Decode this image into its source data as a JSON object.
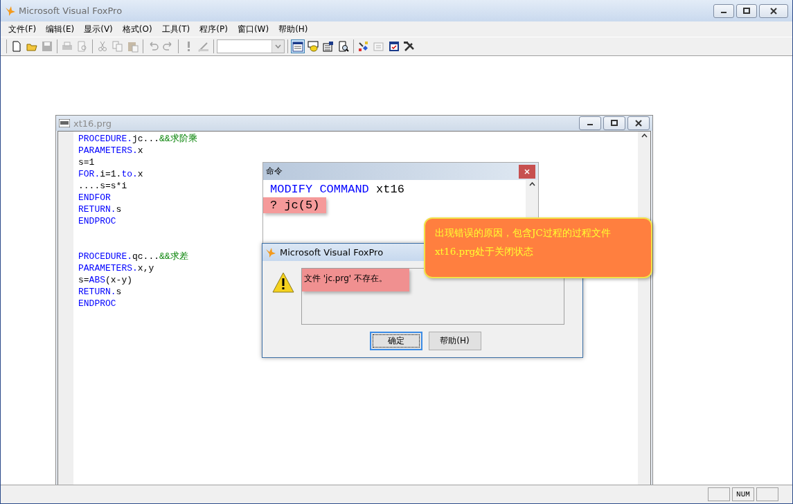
{
  "window": {
    "title": "Microsoft Visual FoxPro"
  },
  "menu": [
    "文件(F)",
    "编辑(E)",
    "显示(V)",
    "格式(O)",
    "工具(T)",
    "程序(P)",
    "窗口(W)",
    "帮助(H)"
  ],
  "toolbar": [
    [
      {
        "kind": "new",
        "disabled": false
      },
      {
        "kind": "open",
        "disabled": false
      },
      {
        "kind": "save",
        "disabled": true
      }
    ],
    [
      {
        "kind": "print",
        "disabled": true
      },
      {
        "kind": "preview",
        "disabled": true
      }
    ],
    [
      {
        "kind": "cut",
        "disabled": true
      },
      {
        "kind": "copy",
        "disabled": true
      },
      {
        "kind": "paste",
        "disabled": true
      }
    ],
    [
      {
        "kind": "undo",
        "disabled": true
      },
      {
        "kind": "redo",
        "disabled": true
      }
    ],
    [
      {
        "kind": "run",
        "disabled": true
      },
      {
        "kind": "wizard",
        "disabled": true
      }
    ],
    [
      {
        "kind": "combo",
        "disabled": true
      }
    ],
    [
      {
        "kind": "command",
        "disabled": false,
        "selected": true
      },
      {
        "kind": "data",
        "disabled": false,
        "selected": false
      },
      {
        "kind": "properties",
        "disabled": false,
        "selected": false
      },
      {
        "kind": "find",
        "disabled": false,
        "selected": false
      }
    ],
    [
      {
        "kind": "builder",
        "disabled": false
      },
      {
        "kind": "autoformat",
        "disabled": true
      },
      {
        "kind": "form",
        "disabled": false
      },
      {
        "kind": "tools",
        "disabled": false
      }
    ]
  ],
  "editor": {
    "title": "xt16.prg",
    "blocks": [
      [
        [
          {
            "text": "PROCEDURE.",
            "kind": "keyword"
          },
          {
            "text": "jc...",
            "kind": "plain"
          },
          {
            "text": "&&求阶乘",
            "kind": "comment"
          }
        ],
        [
          {
            "text": "PARAMETERS.",
            "kind": "keyword"
          },
          {
            "text": "x",
            "kind": "plain"
          }
        ],
        [
          {
            "text": "s=1",
            "kind": "plain"
          }
        ],
        [
          {
            "text": "FOR.",
            "kind": "keyword"
          },
          {
            "text": "i=1.",
            "kind": "plain"
          },
          {
            "text": "to.",
            "kind": "keyword"
          },
          {
            "text": "x",
            "kind": "plain"
          }
        ],
        [
          {
            "text": "....s=s*i",
            "kind": "plain"
          }
        ],
        [
          {
            "text": "ENDFOR",
            "kind": "keyword"
          }
        ],
        [
          {
            "text": "RETURN.",
            "kind": "keyword"
          },
          {
            "text": "s",
            "kind": "plain"
          }
        ],
        [
          {
            "text": "ENDPROC",
            "kind": "keyword"
          }
        ]
      ],
      [
        [
          {
            "text": "PROCEDURE.",
            "kind": "keyword"
          },
          {
            "text": "qc...",
            "kind": "plain"
          },
          {
            "text": "&&求差",
            "kind": "comment"
          }
        ],
        [
          {
            "text": "PARAMETERS.",
            "kind": "keyword"
          },
          {
            "text": "x,y",
            "kind": "plain"
          }
        ],
        [
          {
            "text": "s=",
            "kind": "plain"
          },
          {
            "text": "ABS",
            "kind": "keyword"
          },
          {
            "text": "(x-y)",
            "kind": "plain"
          }
        ],
        [
          {
            "text": "RETURN.",
            "kind": "keyword"
          },
          {
            "text": "s",
            "kind": "plain"
          }
        ],
        [
          {
            "text": "ENDPROC",
            "kind": "keyword"
          }
        ]
      ]
    ]
  },
  "command_window": {
    "title": "命令",
    "lines": [
      {
        "highlighted": false,
        "segments": [
          {
            "text": "MODIFY COMMAND",
            "kind": "keyword"
          },
          {
            "text": " xt16",
            "kind": "plain"
          }
        ]
      },
      {
        "highlighted": true,
        "segments": [
          {
            "text": "? jc(5)",
            "kind": "plain"
          }
        ]
      }
    ]
  },
  "callout": {
    "text": "出现错误的原因，包含JC过程的过程文件xt16.prg处于关闭状态"
  },
  "dialog": {
    "title": "Microsoft Visual FoxPro",
    "message": "文件 'jc.prg' 不存在。",
    "message_highlighted": true,
    "buttons": [
      {
        "label": "确定",
        "selected": true
      },
      {
        "label": "帮助(H)",
        "selected": false
      }
    ]
  },
  "status_bar": {
    "panels": [
      "NUM"
    ]
  }
}
